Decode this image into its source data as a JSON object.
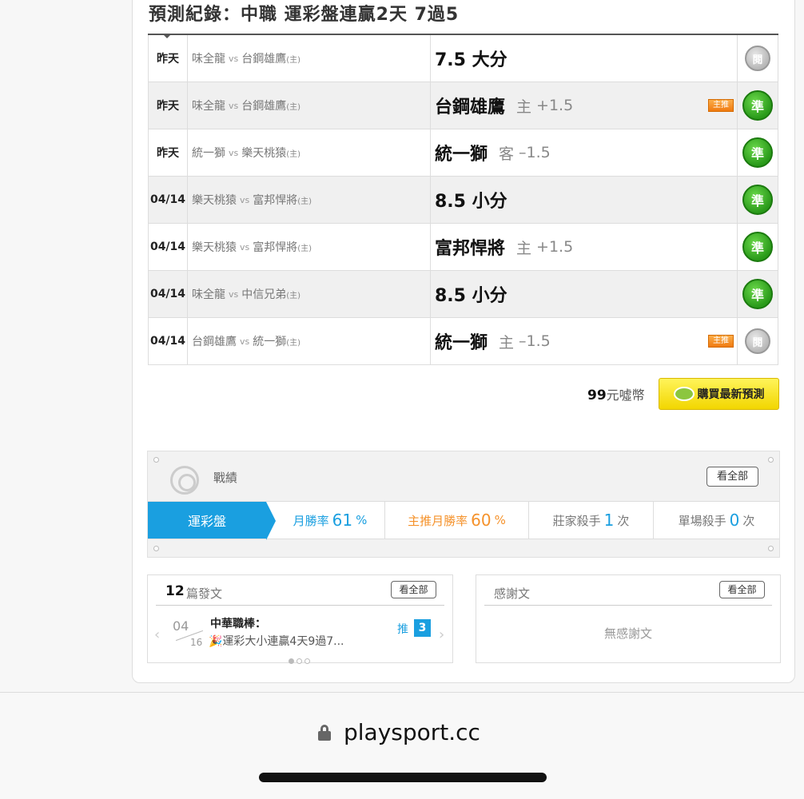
{
  "header": {
    "title": "預測紀錄：中職 運彩盤連贏2天 7過5"
  },
  "rows": [
    {
      "date": "昨天",
      "away": "味全龍",
      "vs": "vs",
      "home": "台鋼雄鷹",
      "home_mark": "(主)",
      "pick_main": "7.5 大分",
      "pick_side": "",
      "pick_spread": "",
      "featured": "",
      "result": "閱",
      "result_type": "push"
    },
    {
      "date": "昨天",
      "away": "味全龍",
      "vs": "vs",
      "home": "台鋼雄鷹",
      "home_mark": "(主)",
      "pick_main": "台鋼雄鷹",
      "pick_side": "主",
      "pick_spread": "+1.5",
      "featured": "主推",
      "result": "準",
      "result_type": "win"
    },
    {
      "date": "昨天",
      "away": "統一獅",
      "vs": "vs",
      "home": "樂天桃猿",
      "home_mark": "(主)",
      "pick_main": "統一獅",
      "pick_side": "客",
      "pick_spread": "–1.5",
      "featured": "",
      "result": "準",
      "result_type": "win"
    },
    {
      "date": "04/14",
      "away": "樂天桃猿",
      "vs": "vs",
      "home": "富邦悍將",
      "home_mark": "(主)",
      "pick_main": "8.5 小分",
      "pick_side": "",
      "pick_spread": "",
      "featured": "",
      "result": "準",
      "result_type": "win"
    },
    {
      "date": "04/14",
      "away": "樂天桃猿",
      "vs": "vs",
      "home": "富邦悍將",
      "home_mark": "(主)",
      "pick_main": "富邦悍將",
      "pick_side": "主",
      "pick_spread": "+1.5",
      "featured": "",
      "result": "準",
      "result_type": "win"
    },
    {
      "date": "04/14",
      "away": "味全龍",
      "vs": "vs",
      "home": "中信兄弟",
      "home_mark": "(主)",
      "pick_main": "8.5 小分",
      "pick_side": "",
      "pick_spread": "",
      "featured": "",
      "result": "準",
      "result_type": "win"
    },
    {
      "date": "04/14",
      "away": "台鋼雄鷹",
      "vs": "vs",
      "home": "統一獅",
      "home_mark": "(主)",
      "pick_main": "統一獅",
      "pick_side": "主",
      "pick_spread": "–1.5",
      "featured": "主推",
      "result": "閱",
      "result_type": "push"
    }
  ],
  "purchase": {
    "price": "99",
    "unit": "元噓幣",
    "button_label": "購買最新預測"
  },
  "stats": {
    "label": "戰績",
    "view_all": "看全部",
    "active_tab": "運彩盤",
    "monthly_label": "月勝率",
    "monthly_value": "61",
    "monthly_unit": "%",
    "featured_label": "主推月勝率",
    "featured_value": "60",
    "featured_unit": "%",
    "house_label": "莊家殺手",
    "house_value": "1",
    "house_unit": "次",
    "single_label": "單場殺手",
    "single_value": "0",
    "single_unit": "次"
  },
  "posts": {
    "count": "12",
    "count_label": "篇發文",
    "view_all": "看全部",
    "item": {
      "month": "04",
      "day": "16",
      "title": "中華職棒：",
      "snippet": "🎉運彩大小連贏4天9過7...",
      "push_label": "推",
      "push_count": "3"
    }
  },
  "thanks": {
    "label": "感謝文",
    "view_all": "看全部",
    "empty": "無感謝文"
  },
  "browser": {
    "url": "playsport.cc"
  },
  "colors": {
    "accent": "#1a9fe0",
    "orange": "#f5922b",
    "win_green": "#2a9a1a",
    "buy_yellow": "#f2d600"
  }
}
